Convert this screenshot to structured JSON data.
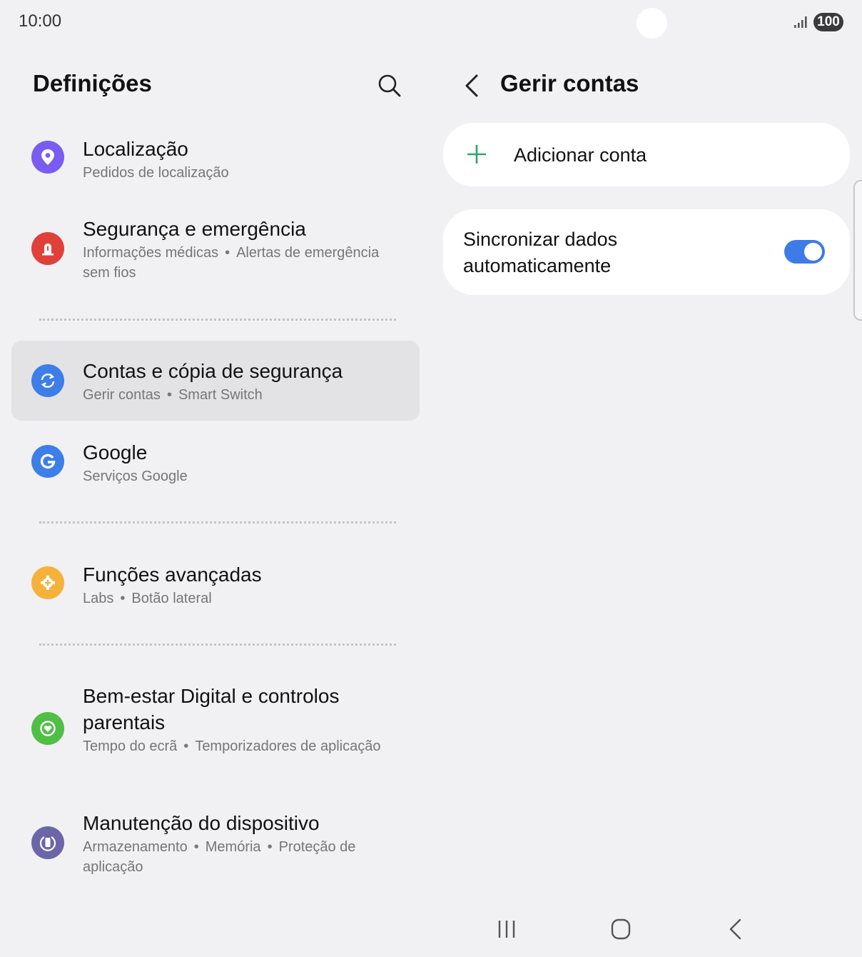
{
  "status_bar": {
    "time": "10:00",
    "battery": "100"
  },
  "left_pane": {
    "title": "Definições",
    "items": [
      {
        "title": "Localização",
        "subtitle_parts": [
          "Pedidos de localização"
        ],
        "icon": "location-pin-icon",
        "color": "#7a5cf0"
      },
      {
        "title": "Segurança e emergência",
        "subtitle_parts": [
          "Informações médicas",
          "Alertas de emergência sem fios"
        ],
        "icon": "siren-icon",
        "color": "#e0403a"
      },
      {
        "title": "Contas e cópia de segurança",
        "subtitle_parts": [
          "Gerir contas",
          "Smart Switch"
        ],
        "icon": "sync-icon",
        "color": "#3d7ee8",
        "selected": true
      },
      {
        "title": "Google",
        "subtitle_parts": [
          "Serviços Google"
        ],
        "icon": "google-g-icon",
        "color": "#3d7ee8"
      },
      {
        "title": "Funções avançadas",
        "subtitle_parts": [
          "Labs",
          "Botão lateral"
        ],
        "icon": "gear-plus-icon",
        "color": "#f5b23b"
      },
      {
        "title": "Bem-estar Digital e controlos parentais",
        "subtitle_parts": [
          "Tempo do ecrã",
          "Temporizadores de aplicação"
        ],
        "icon": "heart-circle-icon",
        "color": "#4fbf46"
      },
      {
        "title": "Manutenção do dispositivo",
        "subtitle_parts": [
          "Armazenamento",
          "Memória",
          "Proteção de aplicação"
        ],
        "icon": "device-care-icon",
        "color": "#6a66a8"
      }
    ]
  },
  "right_pane": {
    "title": "Gerir contas",
    "add_account_label": "Adicionar conta",
    "sync_label": "Sincronizar dados automaticamente",
    "sync_enabled": true,
    "accent_color": "#3e7be6",
    "plus_color": "#2aa76a"
  },
  "nav": {
    "icons": [
      "recents-icon",
      "home-icon",
      "back-icon"
    ]
  }
}
